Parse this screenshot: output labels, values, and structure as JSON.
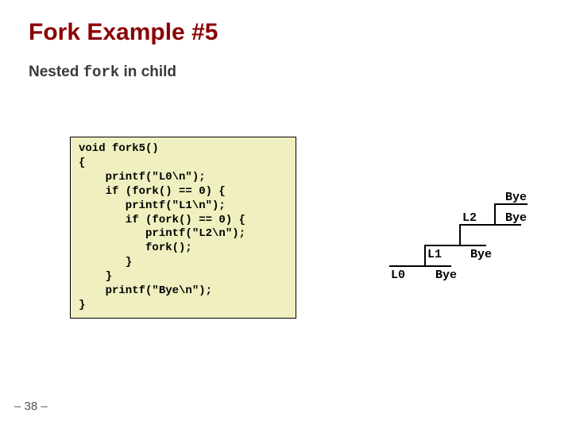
{
  "title": "Fork Example #5",
  "subtitle_prefix": "Nested ",
  "subtitle_code": "fork",
  "subtitle_suffix": " in child",
  "code": "void fork5()\n{\n    printf(\"L0\\n\");\n    if (fork() == 0) {\n       printf(\"L1\\n\");\n       if (fork() == 0) {\n          printf(\"L2\\n\");\n          fork();\n       }\n    }\n    printf(\"Bye\\n\");\n}",
  "labels": {
    "l0": "L0",
    "l1": "L1",
    "l2": "L2",
    "bye0": "Bye",
    "bye1": "Bye",
    "bye2": "Bye",
    "bye3": "Bye"
  },
  "pagenum": "– 38 –"
}
